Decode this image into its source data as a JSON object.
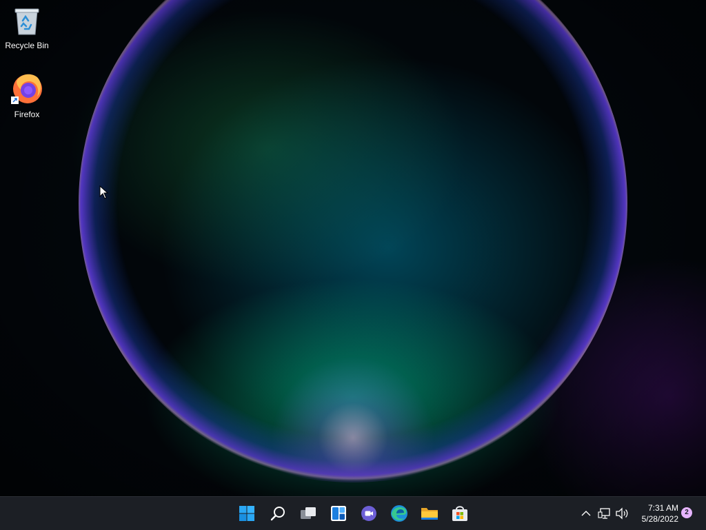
{
  "desktop": {
    "icons": [
      {
        "label": "Recycle Bin",
        "icon": "recycle-bin-icon"
      },
      {
        "label": "Firefox",
        "icon": "firefox-icon"
      }
    ]
  },
  "taskbar": {
    "apps": [
      {
        "name": "start",
        "icon": "windows-start-icon"
      },
      {
        "name": "search",
        "icon": "search-icon"
      },
      {
        "name": "task-view",
        "icon": "task-view-icon"
      },
      {
        "name": "widgets",
        "icon": "widgets-icon"
      },
      {
        "name": "chat",
        "icon": "teams-chat-icon"
      },
      {
        "name": "edge",
        "icon": "edge-icon"
      },
      {
        "name": "file-explorer",
        "icon": "file-explorer-icon"
      },
      {
        "name": "store",
        "icon": "store-icon"
      }
    ],
    "tray": {
      "time": "7:31 AM",
      "date": "5/28/2022",
      "notification_count": "2"
    }
  },
  "colors": {
    "accent": "#0078d4",
    "taskbar_bg": "#1c1f25",
    "badge": "#e6b4ff"
  }
}
